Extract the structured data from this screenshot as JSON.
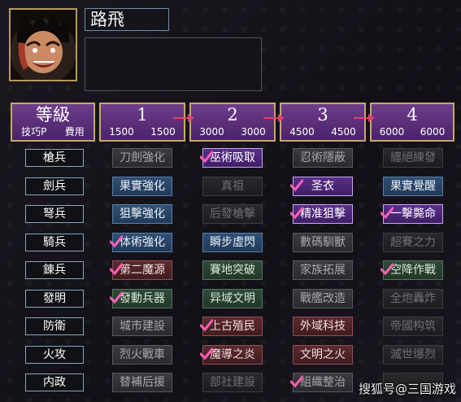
{
  "character": {
    "name": "路飛",
    "description": ""
  },
  "header": {
    "title": "等級",
    "sub_left": "技巧P",
    "sub_right": "費用",
    "levels": [
      {
        "num": "1",
        "skill_p": "1500",
        "cost": "1500"
      },
      {
        "num": "2",
        "skill_p": "3000",
        "cost": "3000"
      },
      {
        "num": "3",
        "skill_p": "4500",
        "cost": "4500"
      },
      {
        "num": "4",
        "skill_p": "6000",
        "cost": "6000"
      }
    ]
  },
  "rows": [
    {
      "label": "槍兵",
      "cells": [
        {
          "text": "刀劍強化",
          "state": "grey",
          "checked": false
        },
        {
          "text": "巫術吸取",
          "state": "purple",
          "checked": true
        },
        {
          "text": "忍術隱蔽",
          "state": "grey",
          "checked": false
        },
        {
          "text": "纏絕練發",
          "state": "dark",
          "checked": false
        }
      ]
    },
    {
      "label": "劍兵",
      "cells": [
        {
          "text": "果實強化",
          "state": "blue",
          "checked": false
        },
        {
          "text": "真祖",
          "state": "dark",
          "checked": false
        },
        {
          "text": "圣衣",
          "state": "purple",
          "checked": true
        },
        {
          "text": "果實覺醒",
          "state": "blue",
          "checked": false
        }
      ]
    },
    {
      "label": "弩兵",
      "cells": [
        {
          "text": "狙擊強化",
          "state": "blue",
          "checked": false
        },
        {
          "text": "后發槍擊",
          "state": "dark",
          "checked": false
        },
        {
          "text": "精准狙擊",
          "state": "purple",
          "checked": true
        },
        {
          "text": "一擊斃命",
          "state": "purple",
          "checked": true
        }
      ]
    },
    {
      "label": "騎兵",
      "cells": [
        {
          "text": "体術強化",
          "state": "blue",
          "checked": true
        },
        {
          "text": "瞬步虛閃",
          "state": "blue",
          "checked": false
        },
        {
          "text": "數碼馴獸",
          "state": "grey",
          "checked": false
        },
        {
          "text": "超賽之力",
          "state": "dark",
          "checked": false
        }
      ]
    },
    {
      "label": "錬兵",
      "cells": [
        {
          "text": "第二魔源",
          "state": "red",
          "checked": true
        },
        {
          "text": "賽地突破",
          "state": "green",
          "checked": false
        },
        {
          "text": "家族拓展",
          "state": "grey",
          "checked": false
        },
        {
          "text": "空降作戰",
          "state": "green",
          "checked": true
        }
      ]
    },
    {
      "label": "發明",
      "cells": [
        {
          "text": "發動兵器",
          "state": "green",
          "checked": true
        },
        {
          "text": "异域文明",
          "state": "green",
          "checked": false
        },
        {
          "text": "戰艦改造",
          "state": "grey",
          "checked": false
        },
        {
          "text": "全炮轟炸",
          "state": "dark",
          "checked": false
        }
      ]
    },
    {
      "label": "防衛",
      "cells": [
        {
          "text": "城市建設",
          "state": "grey",
          "checked": false
        },
        {
          "text": "上古殖民",
          "state": "red",
          "checked": true
        },
        {
          "text": "外域科技",
          "state": "red",
          "checked": false
        },
        {
          "text": "帝國构筑",
          "state": "dark",
          "checked": false
        }
      ]
    },
    {
      "label": "火攻",
      "cells": [
        {
          "text": "烈火戰車",
          "state": "grey",
          "checked": false
        },
        {
          "text": "魔導之炎",
          "state": "red",
          "checked": true
        },
        {
          "text": "文明之火",
          "state": "red",
          "checked": false
        },
        {
          "text": "滅世爆烈",
          "state": "dark",
          "checked": false
        }
      ]
    },
    {
      "label": "内政",
      "cells": [
        {
          "text": "替補后援",
          "state": "grey",
          "checked": false
        },
        {
          "text": "部社建設",
          "state": "dark",
          "checked": false
        },
        {
          "text": "組織整治",
          "state": "grey",
          "checked": true
        },
        {
          "text": "",
          "state": "dark",
          "checked": false
        }
      ]
    }
  ],
  "watermark": "搜狐号@三国游戏"
}
